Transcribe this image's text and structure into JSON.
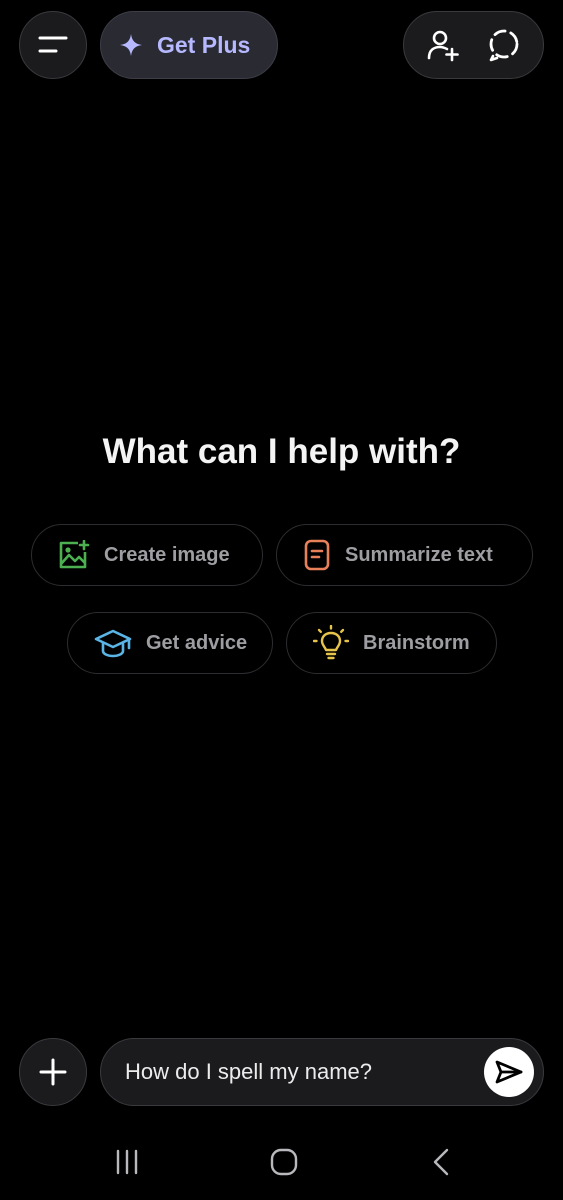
{
  "top_bar": {
    "menu_icon": "menu-icon",
    "get_plus_label": "Get Plus",
    "get_plus_icon": "sparkle-icon",
    "add_person_icon": "add-person-icon",
    "temporary_chat_icon": "dashed-circle-icon"
  },
  "main": {
    "heading": "What can I help with?",
    "suggestions": [
      {
        "label": "Create image",
        "icon": "image-icon",
        "color": "#4caf50"
      },
      {
        "label": "Summarize text",
        "icon": "document-icon",
        "color": "#e8815a"
      },
      {
        "label": "Get advice",
        "icon": "graduation-cap-icon",
        "color": "#5ab4e6"
      },
      {
        "label": "Brainstorm",
        "icon": "lightbulb-icon",
        "color": "#e6c34a"
      }
    ]
  },
  "composer": {
    "attach_icon": "plus-icon",
    "input_value": "How do I spell my name?",
    "send_icon": "send-icon"
  },
  "nav_bar": {
    "recents_icon": "recents-icon",
    "home_icon": "home-icon",
    "back_icon": "back-icon"
  },
  "colors": {
    "background": "#000000",
    "get_plus_accent": "#b6b9ff"
  }
}
